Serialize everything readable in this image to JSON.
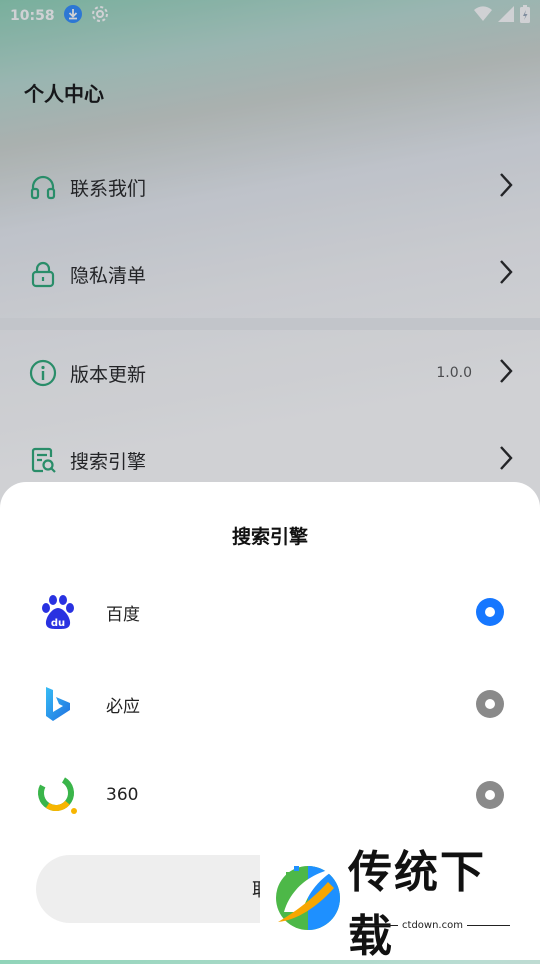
{
  "status_bar": {
    "time": "10:58"
  },
  "page": {
    "title": "个人中心",
    "items": [
      {
        "label": "联系我们",
        "icon": "headset-icon"
      },
      {
        "label": "隐私清单",
        "icon": "lock-icon"
      },
      {
        "label": "版本更新",
        "icon": "info-icon",
        "value": "1.0.0"
      },
      {
        "label": "搜索引擎",
        "icon": "search-doc-icon"
      }
    ]
  },
  "sheet": {
    "title": "搜索引擎",
    "engines": [
      {
        "name": "百度",
        "logo": "baidu-logo",
        "selected": true
      },
      {
        "name": "必应",
        "logo": "bing-logo",
        "selected": false
      },
      {
        "name": "360",
        "logo": "360-logo",
        "selected": false
      }
    ],
    "cancel_label": "取消"
  },
  "watermark": {
    "text": "传统下载",
    "sub": "ctdown.com"
  },
  "colors": {
    "accent_green": "#2aa876",
    "radio_on": "#1677ff",
    "radio_off": "#8a8a8a"
  }
}
